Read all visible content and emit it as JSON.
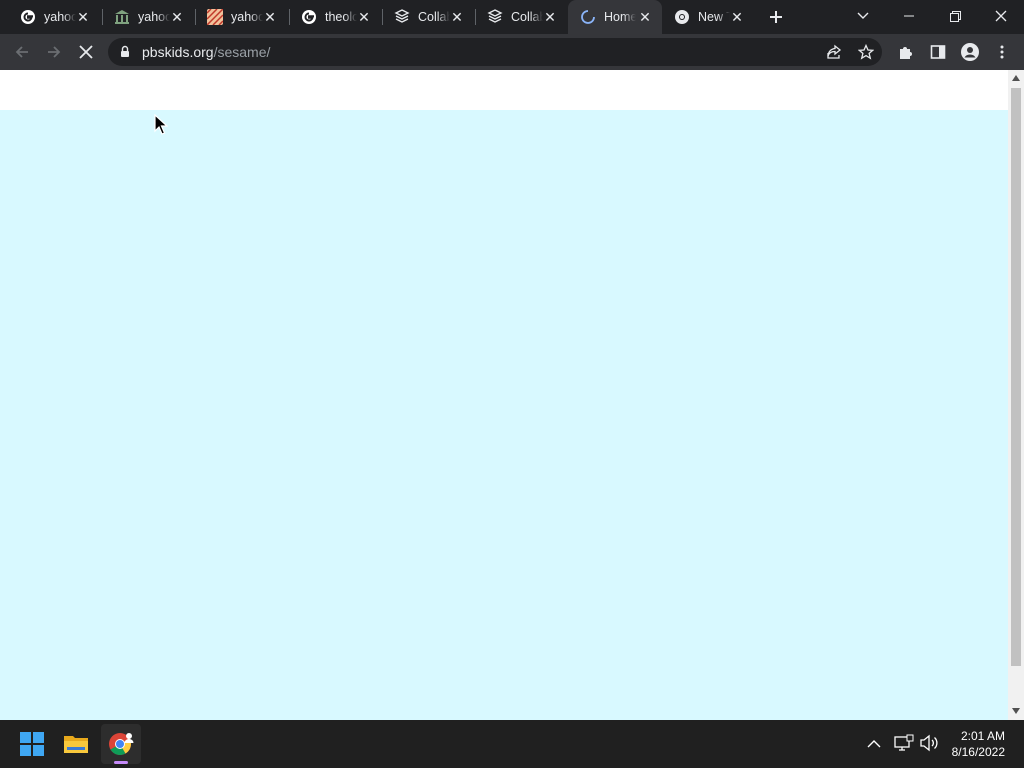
{
  "browser": {
    "tabs": [
      {
        "title": "yahoo",
        "icon": "google-icon",
        "active": false
      },
      {
        "title": "yahoo",
        "icon": "museum-icon",
        "active": false
      },
      {
        "title": "yahoo",
        "icon": "pattern-icon",
        "active": false
      },
      {
        "title": "theolo",
        "icon": "google-icon",
        "active": false
      },
      {
        "title": "Collab",
        "icon": "collab-icon",
        "active": false
      },
      {
        "title": "Collab",
        "icon": "collab-icon",
        "active": false
      },
      {
        "title": "Home",
        "icon": "loading-spinner-icon",
        "active": true
      },
      {
        "title": "New T",
        "icon": "chrome-icon",
        "active": false
      }
    ],
    "address": {
      "domain": "pbskids.org",
      "path": "/sesame/"
    },
    "page_background": "#d8f9ff"
  },
  "taskbar": {
    "time": "2:01 AM",
    "date": "8/16/2022"
  }
}
